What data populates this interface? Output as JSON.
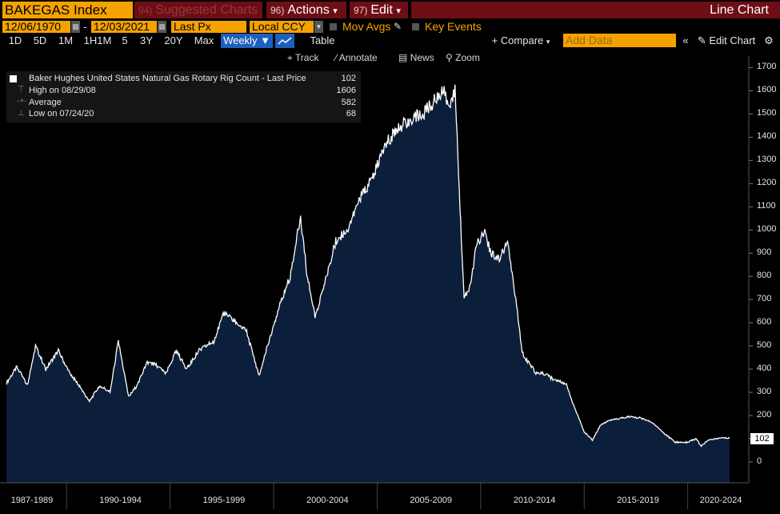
{
  "topbar": {
    "ticker": "BAKEGAS Index",
    "suggested": {
      "num": "94)",
      "label": "Suggested Charts"
    },
    "actions": {
      "num": "96)",
      "label": "Actions",
      "arrow": "▾"
    },
    "edit": {
      "num": "97)",
      "label": "Edit",
      "arrow": "▾"
    },
    "title": "Line Chart"
  },
  "params": {
    "start_date": "12/06/1970",
    "end_date": "12/03/2021",
    "dash": "-",
    "price_field": "Last Px",
    "currency": "Local CCY",
    "mov_avgs": "Mov Avgs",
    "key_events": "Key Events"
  },
  "periods": [
    "1D",
    "5D",
    "1M",
    "1H1M",
    "5",
    "3Y",
    "20Y",
    "Max"
  ],
  "frequency": "Weekly",
  "table_label": "Table",
  "compare_label": "Compare",
  "add_data_placeholder": "Add Data",
  "edit_chart_label": "Edit Chart",
  "tools": {
    "track": "Track",
    "annotate": "Annotate",
    "news": "News",
    "zoom": "Zoom"
  },
  "legend": {
    "series": "Baker Hughes United States Natural Gas Rotary Rig Count - Last Price",
    "last": "102",
    "high_label": "High on 08/29/08",
    "high": "1606",
    "avg_label": "Average",
    "avg": "582",
    "low_label": "Low on 07/24/20",
    "low": "68"
  },
  "last_value_tag": "102",
  "colors": {
    "accent": "#f5a200",
    "header_red": "#6e0e14",
    "area_fill": "#0b1e3a",
    "line": "#ffffff",
    "blue_btn": "#1d5fbf"
  },
  "chart_data": {
    "type": "area",
    "series": [
      {
        "name": "Baker Hughes United States Natural Gas Rotary Rig Count - Last Price",
        "x": [
          1987.0,
          1987.5,
          1988.0,
          1988.4,
          1988.9,
          1989.5,
          1990.0,
          1990.5,
          1991.0,
          1991.5,
          1992.0,
          1992.4,
          1992.9,
          1993.3,
          1993.8,
          1994.2,
          1994.7,
          1995.2,
          1995.7,
          1996.3,
          1997.0,
          1997.5,
          1998.0,
          1998.6,
          1999.2,
          1999.6,
          2000.1,
          2000.7,
          2001.2,
          2001.5,
          2001.9,
          2002.3,
          2002.9,
          2003.5,
          2004.1,
          2004.7,
          2005.3,
          2005.9,
          2006.5,
          2007.1,
          2007.7,
          2008.1,
          2008.4,
          2008.66,
          2008.9,
          2009.1,
          2009.4,
          2009.7,
          2010.1,
          2010.4,
          2010.8,
          2011.2,
          2011.6,
          2011.9,
          2012.2,
          2012.6,
          2013.0,
          2013.5,
          2014.0,
          2014.5,
          2014.9,
          2015.3,
          2015.7,
          2016.1,
          2016.5,
          2017.0,
          2017.6,
          2018.2,
          2018.8,
          2019.3,
          2019.9,
          2020.3,
          2020.56,
          2020.9,
          2021.3,
          2021.7,
          2021.92
        ],
        "y": [
          340,
          410,
          330,
          500,
          400,
          480,
          390,
          330,
          260,
          330,
          300,
          520,
          280,
          330,
          430,
          420,
          380,
          480,
          400,
          480,
          520,
          640,
          610,
          560,
          370,
          500,
          650,
          800,
          1060,
          820,
          620,
          750,
          950,
          1010,
          1140,
          1230,
          1370,
          1440,
          1480,
          1500,
          1560,
          1600,
          1520,
          1606,
          1100,
          700,
          760,
          940,
          990,
          900,
          880,
          940,
          700,
          470,
          430,
          380,
          380,
          350,
          340,
          220,
          130,
          95,
          160,
          180,
          185,
          195,
          190,
          170,
          120,
          85,
          85,
          100,
          68,
          95,
          100,
          105,
          102
        ]
      }
    ],
    "xlim": [
      1986.8,
      2022.0
    ],
    "ylim": [
      -90,
      1750
    ],
    "yticks": [
      0,
      100,
      200,
      300,
      400,
      500,
      600,
      700,
      800,
      900,
      1000,
      1100,
      1200,
      1300,
      1400,
      1500,
      1600,
      1700
    ],
    "xlabels": [
      {
        "label": "1987-1989",
        "x": 1988.2
      },
      {
        "label": "1990-1994",
        "x": 1992.5
      },
      {
        "label": "1995-1999",
        "x": 1997.5
      },
      {
        "label": "2000-2004",
        "x": 2002.5
      },
      {
        "label": "2005-2009",
        "x": 2007.5
      },
      {
        "label": "2010-2014",
        "x": 2012.5
      },
      {
        "label": "2015-2019",
        "x": 2017.5
      },
      {
        "label": "2020-2024",
        "x": 2021.5
      }
    ],
    "xdividers": [
      1989.9,
      1994.9,
      1999.9,
      2004.9,
      2009.9,
      2014.9,
      2019.9
    ],
    "grid": false,
    "legend_position": "top-left"
  }
}
